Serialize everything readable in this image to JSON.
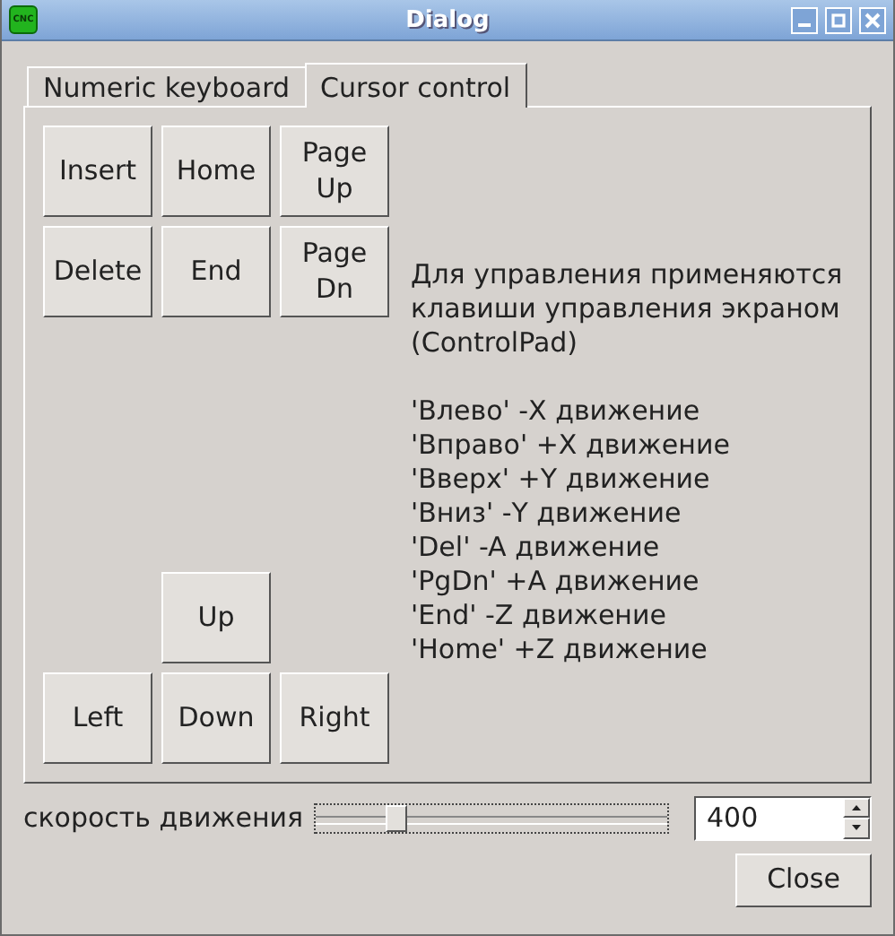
{
  "window": {
    "title": "Dialog",
    "app_icon_text": "CNC"
  },
  "tabs": [
    {
      "label": "Numeric keyboard",
      "selected": false
    },
    {
      "label": "Cursor control",
      "selected": true
    }
  ],
  "edit_keys": [
    [
      {
        "label": "Insert"
      },
      {
        "label": "Home"
      },
      {
        "label": "Page\nUp"
      }
    ],
    [
      {
        "label": "Delete"
      },
      {
        "label": "End"
      },
      {
        "label": "Page\nDn"
      }
    ]
  ],
  "arrow_keys": [
    [
      {
        "kind": "blank"
      },
      {
        "kind": "key",
        "label": "Up"
      },
      {
        "kind": "blank"
      }
    ],
    [
      {
        "kind": "key",
        "label": "Left"
      },
      {
        "kind": "key",
        "label": "Down"
      },
      {
        "kind": "key",
        "label": "Right"
      }
    ]
  ],
  "info": {
    "intro": "Для управления применяются клавиши управления экраном (ControlPad)",
    "mappings": [
      "'Влево' -X движение",
      "'Вправо' +X движение",
      "'Вверх' +Y движение",
      "'Вниз' -Y движение",
      "'Del' -A движение",
      "'PgDn' +A движение",
      "'End' -Z движение",
      "'Home' +Z движение"
    ]
  },
  "speed": {
    "label": "скорость движения",
    "level": 0.21,
    "value": "400"
  },
  "buttons": [
    "Close"
  ]
}
